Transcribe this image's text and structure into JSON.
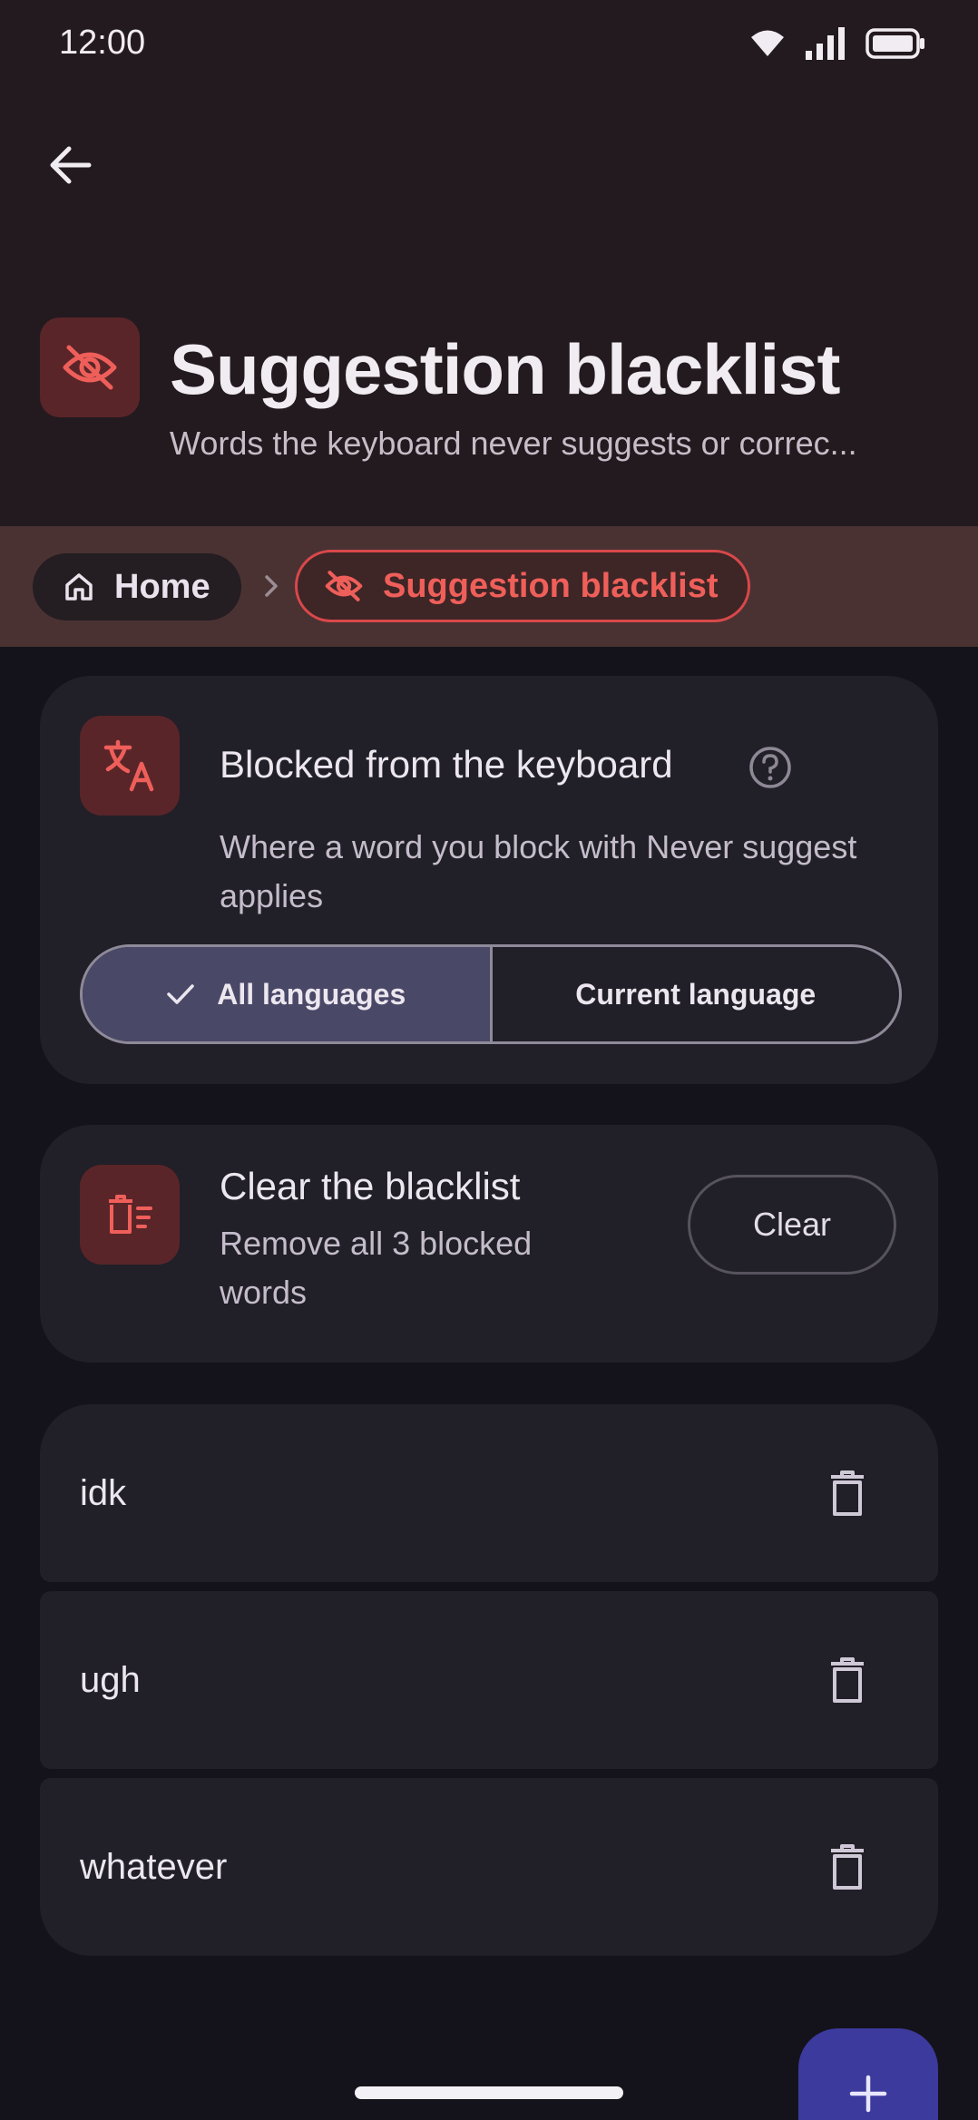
{
  "status_bar": {
    "time": "12:00",
    "icons": [
      "wifi-icon",
      "signal-icon",
      "battery-icon"
    ]
  },
  "header": {
    "back_icon": "arrow-left-icon",
    "icon": "eye-off-icon",
    "title": "Suggestion blacklist",
    "subtitle": "Words the keyboard never suggests or correc..."
  },
  "breadcrumb": {
    "home_label": "Home",
    "home_icon": "home-icon",
    "separator_icon": "chevron-right-icon",
    "current_label": "Suggestion blacklist",
    "current_icon": "eye-off-icon"
  },
  "scope_card": {
    "icon": "translate-icon",
    "title": "Blocked from the keyboard",
    "help_icon": "help-circle-icon",
    "description": "Where a word you block with Never suggest applies",
    "options": [
      {
        "label": "All languages",
        "selected": true
      },
      {
        "label": "Current language",
        "selected": false
      }
    ]
  },
  "clear_card": {
    "icon": "delete-sweep-icon",
    "title": "Clear the blacklist",
    "description": "Remove all 3 blocked words",
    "button_label": "Clear"
  },
  "blacklist": [
    {
      "word": "idk"
    },
    {
      "word": "ugh"
    },
    {
      "word": "whatever"
    }
  ],
  "fab_icon": "plus-icon",
  "colors": {
    "header_bg": "#231a1f",
    "accent_red": "#ef5f5a",
    "icon_tile": "#5a2529",
    "card_bg": "#211f27",
    "selected_segment": "#4a4867",
    "fab": "#3c3a9d"
  }
}
